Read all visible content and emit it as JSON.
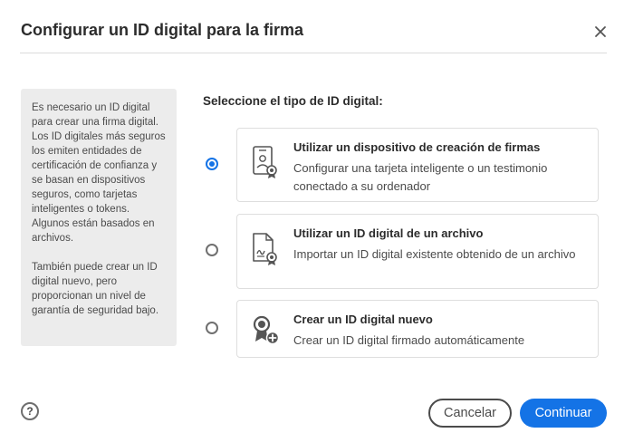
{
  "dialog": {
    "title": "Configurar un ID digital para la firma",
    "close_icon": "close-icon"
  },
  "info_panel": {
    "paragraph1": "Es necesario un ID digital para crear una firma digital. Los ID digitales más seguros los emiten entidades de certificación de confianza y se basan en dispositivos seguros, como tarjetas inteligentes o tokens. Algunos están basados en archivos.",
    "paragraph2": "También puede crear un ID digital nuevo, pero proporcionan un nivel de garantía de seguridad bajo."
  },
  "prompt": "Seleccione el tipo de ID digital:",
  "options": [
    {
      "title": "Utilizar un dispositivo de creación de firmas",
      "description": "Configurar una tarjeta inteligente o un testimonio conectado a su ordenador",
      "icon": "signature-device-icon",
      "selected": true
    },
    {
      "title": "Utilizar un ID digital de un archivo",
      "description": "Importar un ID digital existente obtenido de un archivo",
      "icon": "certificate-file-icon",
      "selected": false
    },
    {
      "title": "Crear un ID digital nuevo",
      "description": "Crear un ID digital firmado automáticamente",
      "icon": "new-certificate-icon",
      "selected": false
    }
  ],
  "footer": {
    "help_label": "?",
    "cancel_label": "Cancelar",
    "continue_label": "Continuar"
  },
  "colors": {
    "accent": "#1473e6",
    "panel_bg": "#ececec",
    "text": "#2c2c2c"
  }
}
